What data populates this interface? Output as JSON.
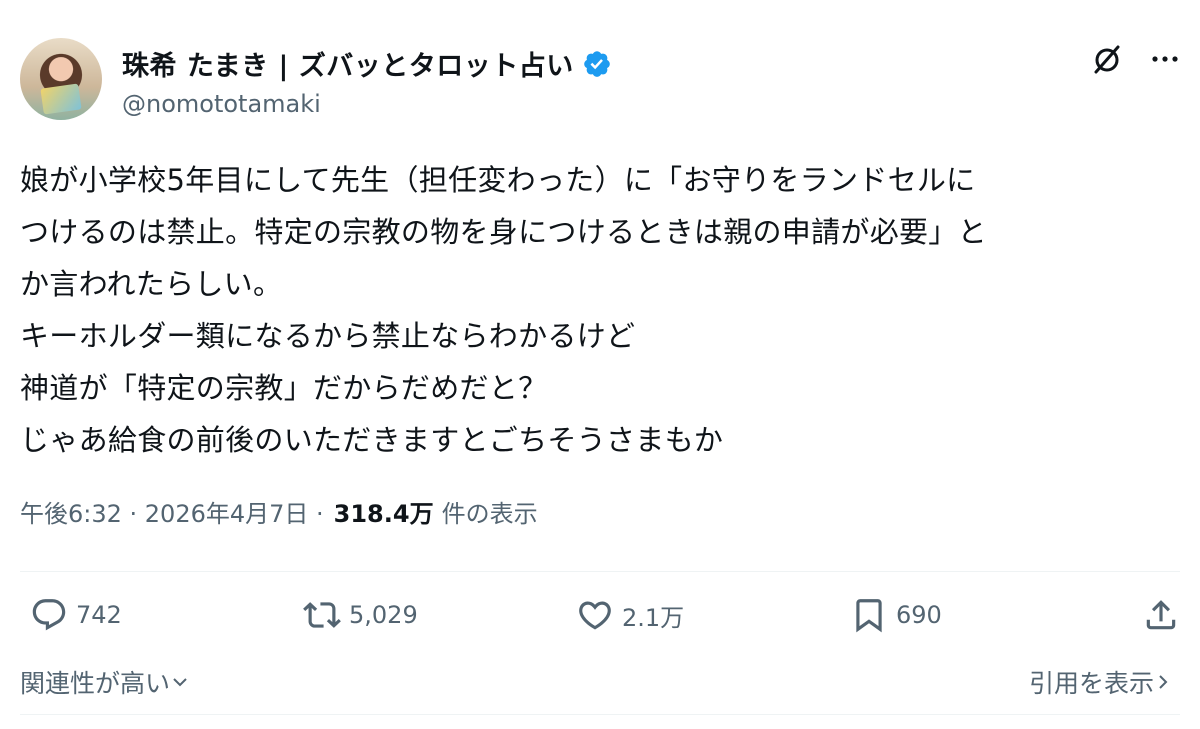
{
  "author": {
    "display_name": "珠希 たまき | ズバッとタロット占い",
    "handle": "@nomototamaki",
    "verified": true,
    "verified_color": "#1d9bf0"
  },
  "post": {
    "lines": [
      "娘が小学校5年目にして先生（担任変わった）に「お守りをランドセルに",
      "つけるのは禁止。特定の宗教の物を身につけるときは親の申請が必要」と",
      "か言われたらしい。",
      "キーホルダー類になるから禁止ならわかるけど",
      "神道が「特定の宗教」だからだめだと？",
      "じゃあ給食の前後のいただきますとごちそうさまもか"
    ],
    "timestamp": "午後6:32 · 2026年4月7日 ·",
    "views_count": "318.4万",
    "views_label": "件の表示"
  },
  "actions": {
    "replies": "742",
    "reposts": "5,029",
    "likes": "2.1万",
    "bookmarks": "690"
  },
  "footer": {
    "sort_label": "関連性が高い",
    "quotes_label": "引用を表示"
  },
  "icons": {
    "avatar": "avatar",
    "verified": "verified-badge-icon",
    "grok": "slash-circle-icon",
    "more": "more-dots-icon",
    "reply": "reply-bubble-icon",
    "repost": "repost-arrows-icon",
    "like": "heart-icon",
    "bookmark": "bookmark-icon",
    "share": "share-upload-icon",
    "chevron_down": "chevron-down-icon",
    "chevron_right": "chevron-right-icon"
  }
}
